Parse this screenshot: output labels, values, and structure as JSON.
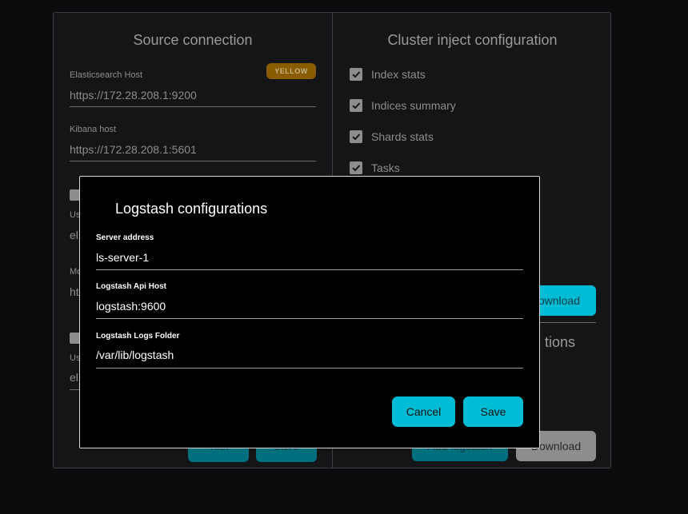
{
  "source_panel": {
    "title": "Source connection",
    "es_host_label": "Elasticsearch Host",
    "es_host_value": "https://172.28.208.1:9200",
    "health_badge": "YELLOW",
    "kibana_label": "Kibana host",
    "kibana_value": "https://172.28.208.1:5601",
    "partial_labels": [
      "Us",
      "Mo",
      "Us"
    ],
    "partial_values": [
      "el",
      "ht",
      "el"
    ],
    "btn_test_partial": "Test",
    "btn_save_partial": "Save"
  },
  "cluster_panel": {
    "title": "Cluster inject configuration",
    "checks": [
      {
        "label": "Index stats",
        "checked": true
      },
      {
        "label": "Indices summary",
        "checked": true
      },
      {
        "label": "Shards stats",
        "checked": true
      },
      {
        "label": "Tasks",
        "checked": true
      }
    ],
    "download_partial": "ownload",
    "options_partial": "tions",
    "bottom_btn_partial": "Add logstash",
    "bottom_download": "Download"
  },
  "modal": {
    "title": "Logstash configurations",
    "fields": [
      {
        "label": "Server address",
        "value": "ls-server-1"
      },
      {
        "label": "Logstash Api Host",
        "value": "logstash:9600"
      },
      {
        "label": "Logstash Logs Folder",
        "value": "/var/lib/logstash"
      }
    ],
    "cancel_label": "Cancel",
    "save_label": "Save"
  },
  "colors": {
    "accent": "#00bcd4",
    "badge": "#8a5c00"
  }
}
